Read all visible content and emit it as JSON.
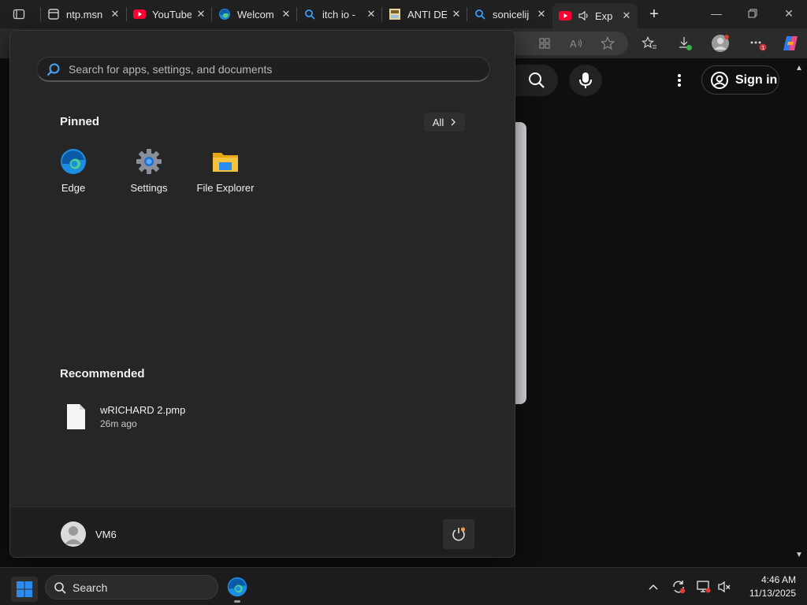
{
  "browser": {
    "tabs": [
      {
        "title": "ntp.msn",
        "icon": "msn-page-icon"
      },
      {
        "title": "YouTube",
        "icon": "youtube-icon"
      },
      {
        "title": "Welcom",
        "icon": "edge-icon"
      },
      {
        "title": "itch io -",
        "icon": "search-icon"
      },
      {
        "title": "ANTI DE",
        "icon": "image-icon"
      },
      {
        "title": "sonicelij",
        "icon": "search-icon"
      },
      {
        "title": "Exp",
        "icon": "youtube-icon",
        "active": true,
        "audio": true
      }
    ],
    "new_tab_label": "+"
  },
  "youtube": {
    "sign_in_label": "Sign in"
  },
  "start_menu": {
    "search_placeholder": "Search for apps, settings, and documents",
    "pinned_title": "Pinned",
    "all_label": "All",
    "pinned": [
      {
        "label": "Edge",
        "icon": "edge-icon"
      },
      {
        "label": "Settings",
        "icon": "settings-gear-icon"
      },
      {
        "label": "File Explorer",
        "icon": "folder-icon"
      }
    ],
    "recommended_title": "Recommended",
    "recommended": [
      {
        "name": "wRICHARD 2.pmp",
        "time": "26m ago",
        "icon": "file-icon"
      }
    ],
    "user_name": "VM6"
  },
  "taskbar": {
    "search_label": "Search",
    "time": "4:46 AM",
    "date": "11/13/2025"
  },
  "colors": {
    "youtube_red": "#ff0033",
    "edge_blue": "#1c8de0",
    "folder_yellow": "#f5c23c",
    "windows_blue": "#2b8cf0"
  }
}
